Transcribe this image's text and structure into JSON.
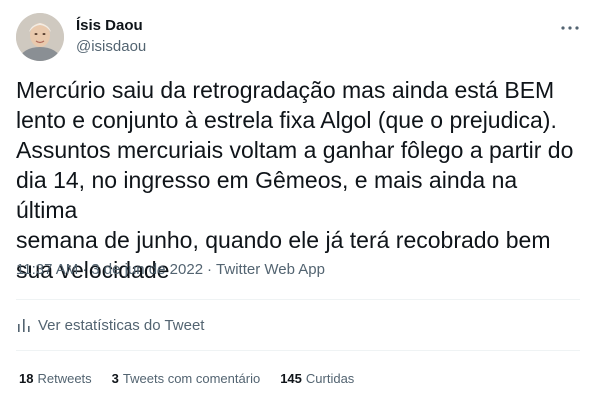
{
  "author": {
    "name": "Ísis Daou",
    "handle": "@isisdaou"
  },
  "tweet": {
    "text": "Mercúrio saiu da retrogradação mas ainda está BEM\nlento e conjunto à estrela fixa Algol (que o prejudica).\nAssuntos mercuriais voltam a ganhar fôlego a partir do\ndia 14, no ingresso em Gêmeos, e mais ainda na última\nsemana de junho, quando ele já terá recobrado bem\nsua velocidade",
    "time": "11:37 AM",
    "date": "3 de jun de 2022",
    "source": "Twitter Web App",
    "separator": "·"
  },
  "analytics": {
    "label": "Ver estatísticas do Tweet",
    "icon": "bar-chart-icon"
  },
  "stats": {
    "retweets_count": "18",
    "retweets_label": "Retweets",
    "quotes_count": "3",
    "quotes_label": "Tweets com comentário",
    "likes_count": "145",
    "likes_label": "Curtidas"
  },
  "icons": {
    "more": "more-horizontal-icon"
  },
  "colors": {
    "text_primary": "#0f1419",
    "text_secondary": "#536471",
    "divider": "#eff3f4"
  }
}
